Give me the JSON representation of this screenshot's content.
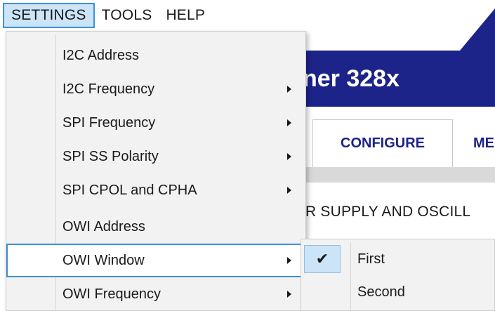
{
  "menubar": {
    "items": [
      {
        "label": "SETTINGS"
      },
      {
        "label": "TOOLS"
      },
      {
        "label": "HELP"
      }
    ]
  },
  "app": {
    "banner_title": "ner 328x",
    "tabs": [
      {
        "label": "CONFIGURE",
        "active": true
      },
      {
        "label": "ME"
      }
    ],
    "section_heading": "R SUPPLY AND OSCILL"
  },
  "settings_menu": {
    "items": [
      {
        "label": "I2C Address",
        "submenu": false
      },
      {
        "label": "I2C Frequency",
        "submenu": true
      },
      {
        "label": "SPI Frequency",
        "submenu": true
      },
      {
        "label": "SPI SS Polarity",
        "submenu": true
      },
      {
        "label": "SPI CPOL and CPHA",
        "submenu": true
      },
      {
        "label": "OWI Address",
        "submenu": false
      },
      {
        "label": "OWI Window",
        "submenu": true,
        "highlighted": true
      },
      {
        "label": "OWI Frequency",
        "submenu": true
      }
    ]
  },
  "owi_window_submenu": {
    "items": [
      {
        "label": "First",
        "checked": true
      },
      {
        "label": "Second",
        "checked": false
      }
    ],
    "check_glyph": "✔"
  },
  "colors": {
    "accent": "#1c2389",
    "highlight_border": "#3f8fd2",
    "highlight_fill": "#cce4f7",
    "menu_bg": "#f2f2f2"
  }
}
